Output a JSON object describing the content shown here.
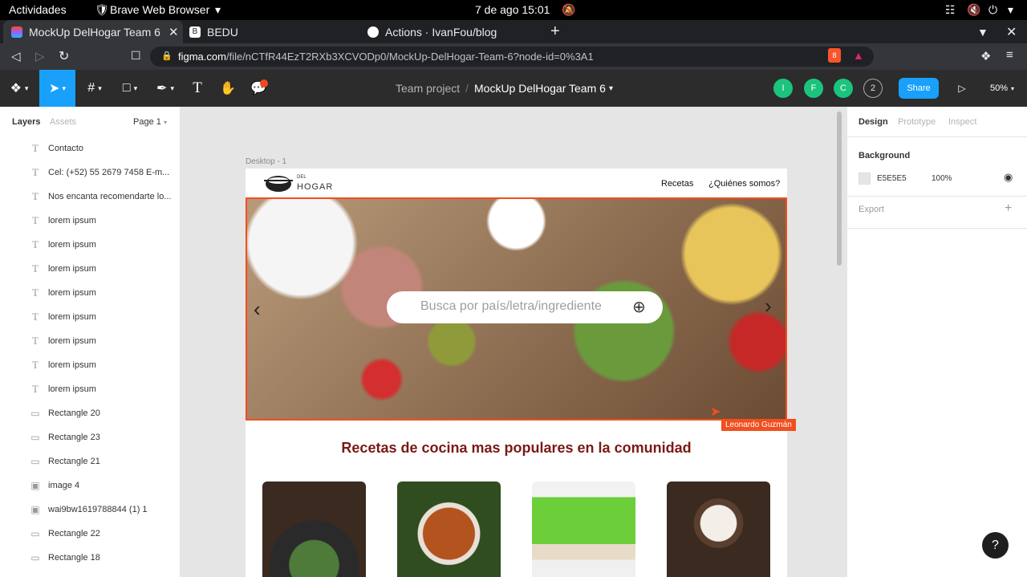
{
  "system": {
    "activities": "Actividades",
    "app_name": "Brave Web Browser",
    "datetime": "7 de ago  15:01"
  },
  "browser": {
    "tabs": [
      {
        "label": "MockUp DelHogar Team 6 -",
        "active": true
      },
      {
        "label": "BEDU",
        "active": false
      },
      {
        "label": "Actions · IvanFou/blog",
        "active": false
      }
    ],
    "url_domain": "figma.com",
    "url_path": "/file/nCTfR44EzT2RXb3XCVODp0/MockUp-DelHogar-Team-6?node-id=0%3A1",
    "brave_badge": "8"
  },
  "figma": {
    "breadcrumb_team": "Team project",
    "breadcrumb_sep": "/",
    "file_name": "MockUp DelHogar Team 6",
    "avatars": [
      {
        "letter": "I",
        "color": "#1bc47d"
      },
      {
        "letter": "F",
        "color": "#1bc47d"
      },
      {
        "letter": "C",
        "color": "#1bc47d"
      }
    ],
    "avatar_count": "2",
    "share_label": "Share",
    "zoom": "50%",
    "accent": "#18a0fb"
  },
  "left_panel": {
    "tab_layers": "Layers",
    "tab_assets": "Assets",
    "page_label": "Page 1",
    "layers": [
      {
        "icon": "text",
        "label": "Contacto"
      },
      {
        "icon": "text",
        "label": "Cel: (+52) 55 2679 7458 E-m..."
      },
      {
        "icon": "text",
        "label": "Nos encanta recomendarte lo..."
      },
      {
        "icon": "text",
        "label": "lorem ipsum"
      },
      {
        "icon": "text",
        "label": "lorem ipsum"
      },
      {
        "icon": "text",
        "label": "lorem ipsum"
      },
      {
        "icon": "text",
        "label": "lorem ipsum"
      },
      {
        "icon": "text",
        "label": "lorem ipsum"
      },
      {
        "icon": "text",
        "label": "lorem ipsum"
      },
      {
        "icon": "text",
        "label": "lorem ipsum"
      },
      {
        "icon": "text",
        "label": "lorem ipsum"
      },
      {
        "icon": "rect",
        "label": "Rectangle 20"
      },
      {
        "icon": "rect",
        "label": "Rectangle 23"
      },
      {
        "icon": "rect",
        "label": "Rectangle 21"
      },
      {
        "icon": "image",
        "label": "image 4"
      },
      {
        "icon": "image",
        "label": "wai9bw1619788844 (1) 1"
      },
      {
        "icon": "rect",
        "label": "Rectangle 22"
      },
      {
        "icon": "rect",
        "label": "Rectangle 18"
      }
    ]
  },
  "canvas": {
    "frame_label": "Desktop - 1",
    "logo_small": "DEL",
    "logo_big": "HOGAR",
    "nav_recetas": "Recetas",
    "nav_quienes": "¿Quiénes somos?",
    "search_placeholder": "Busca por país/letra/ingrediente",
    "section_title": "Recetas de cocina mas populares en la comunidad",
    "cursor_user": "Leonardo Guzmán",
    "cursor_color": "#f24e1e"
  },
  "right_panel": {
    "tab_design": "Design",
    "tab_prototype": "Prototype",
    "tab_inspect": "Inspect",
    "background_label": "Background",
    "bg_hex": "E5E5E5",
    "bg_opacity": "100%",
    "export_label": "Export"
  },
  "help_label": "?"
}
